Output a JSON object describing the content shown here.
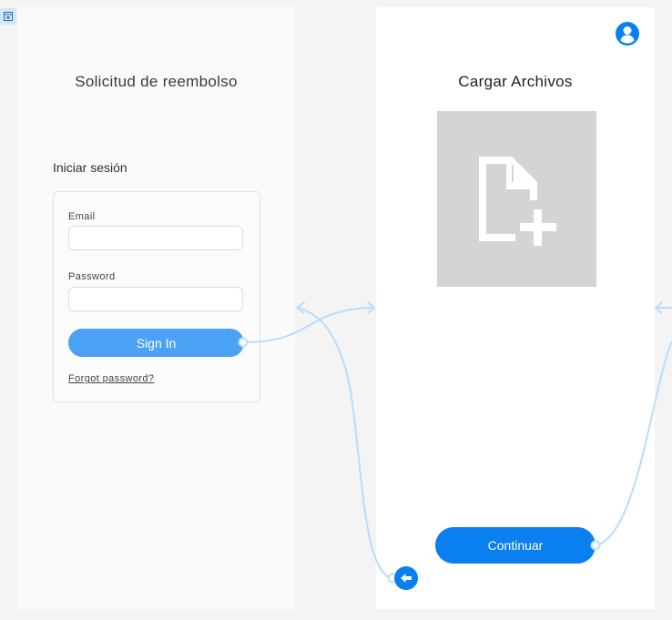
{
  "login_screen": {
    "title": "Solicitud de reembolso",
    "section_heading": "Iniciar sesión",
    "email_label": "Email",
    "email_value": "",
    "password_label": "Password",
    "password_value": "",
    "signin_label": "Sign In",
    "forgot_label": "Forgot password?"
  },
  "upload_screen": {
    "title": "Cargar Archivos",
    "continue_label": "Continuar",
    "user_icon": "user-circle-icon",
    "upload_icon": "file-add-icon",
    "back_icon": "arrow-left-icon"
  },
  "colors": {
    "background": "#f4f4f4",
    "login_button": "#4ba2f5",
    "primary": "#0a7ff0",
    "connector": "#b9dcfa",
    "upload_placeholder": "#d4d4d4"
  }
}
